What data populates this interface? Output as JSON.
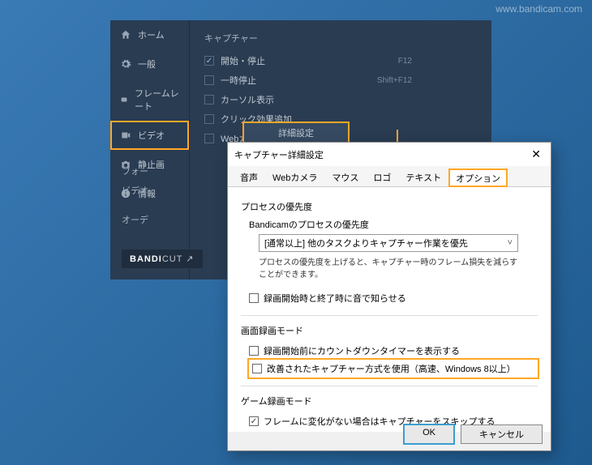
{
  "watermark": "www.bandicam.com",
  "sidebar": {
    "items": [
      {
        "label": "ホーム",
        "icon": "home"
      },
      {
        "label": "一般",
        "icon": "gear"
      },
      {
        "label": "フレームレート",
        "icon": "fps"
      },
      {
        "label": "ビデオ",
        "icon": "video"
      },
      {
        "label": "静止画",
        "icon": "camera"
      },
      {
        "label": "情報",
        "icon": "info"
      }
    ]
  },
  "capture": {
    "section_title": "キャプチャー",
    "items": [
      {
        "label": "開始・停止",
        "checked": true,
        "hotkey": "F12"
      },
      {
        "label": "一時停止",
        "checked": false,
        "hotkey": "Shift+F12"
      },
      {
        "label": "カーソル表示",
        "checked": false,
        "hotkey": ""
      },
      {
        "label": "クリック効果追加",
        "checked": false,
        "hotkey": ""
      },
      {
        "label": "Webカメラオーバーレイ",
        "checked": false,
        "hotkey": ""
      }
    ],
    "detail_button": "詳細設定"
  },
  "misc_labels": {
    "format": "フォー",
    "video": "ビデオ",
    "audio": "オーデ"
  },
  "bandicut": {
    "brand": "BANDI",
    "suffix": "CUT ↗"
  },
  "dialog": {
    "title": "キャプチャー詳細設定",
    "tabs": [
      "音声",
      "Webカメラ",
      "マウス",
      "ロゴ",
      "テキスト",
      "オプション"
    ],
    "active_tab": 5,
    "priority": {
      "title": "プロセスの優先度",
      "sub": "Bandicamのプロセスの優先度",
      "combo": "[通常以上] 他のタスクよりキャプチャー作業を優先",
      "hint": "プロセスの優先度を上げると、キャプチャー時のフレーム損失を減らすことができます。"
    },
    "priority_check": {
      "label": "録画開始時と終了時に音で知らせる",
      "checked": false
    },
    "screen_mode": {
      "title": "画面録画モード",
      "opts": [
        {
          "label": "録画開始前にカウントダウンタイマーを表示する",
          "checked": false,
          "highlight": false
        },
        {
          "label": "改善されたキャプチャー方式を使用（高速、Windows 8以上）",
          "checked": false,
          "highlight": true
        }
      ]
    },
    "game_mode": {
      "title": "ゲーム録画モード",
      "opt": {
        "label": "フレームに変化がない場合はキャプチャーをスキップする",
        "checked": true
      }
    },
    "buttons": {
      "ok": "OK",
      "cancel": "キャンセル"
    }
  }
}
